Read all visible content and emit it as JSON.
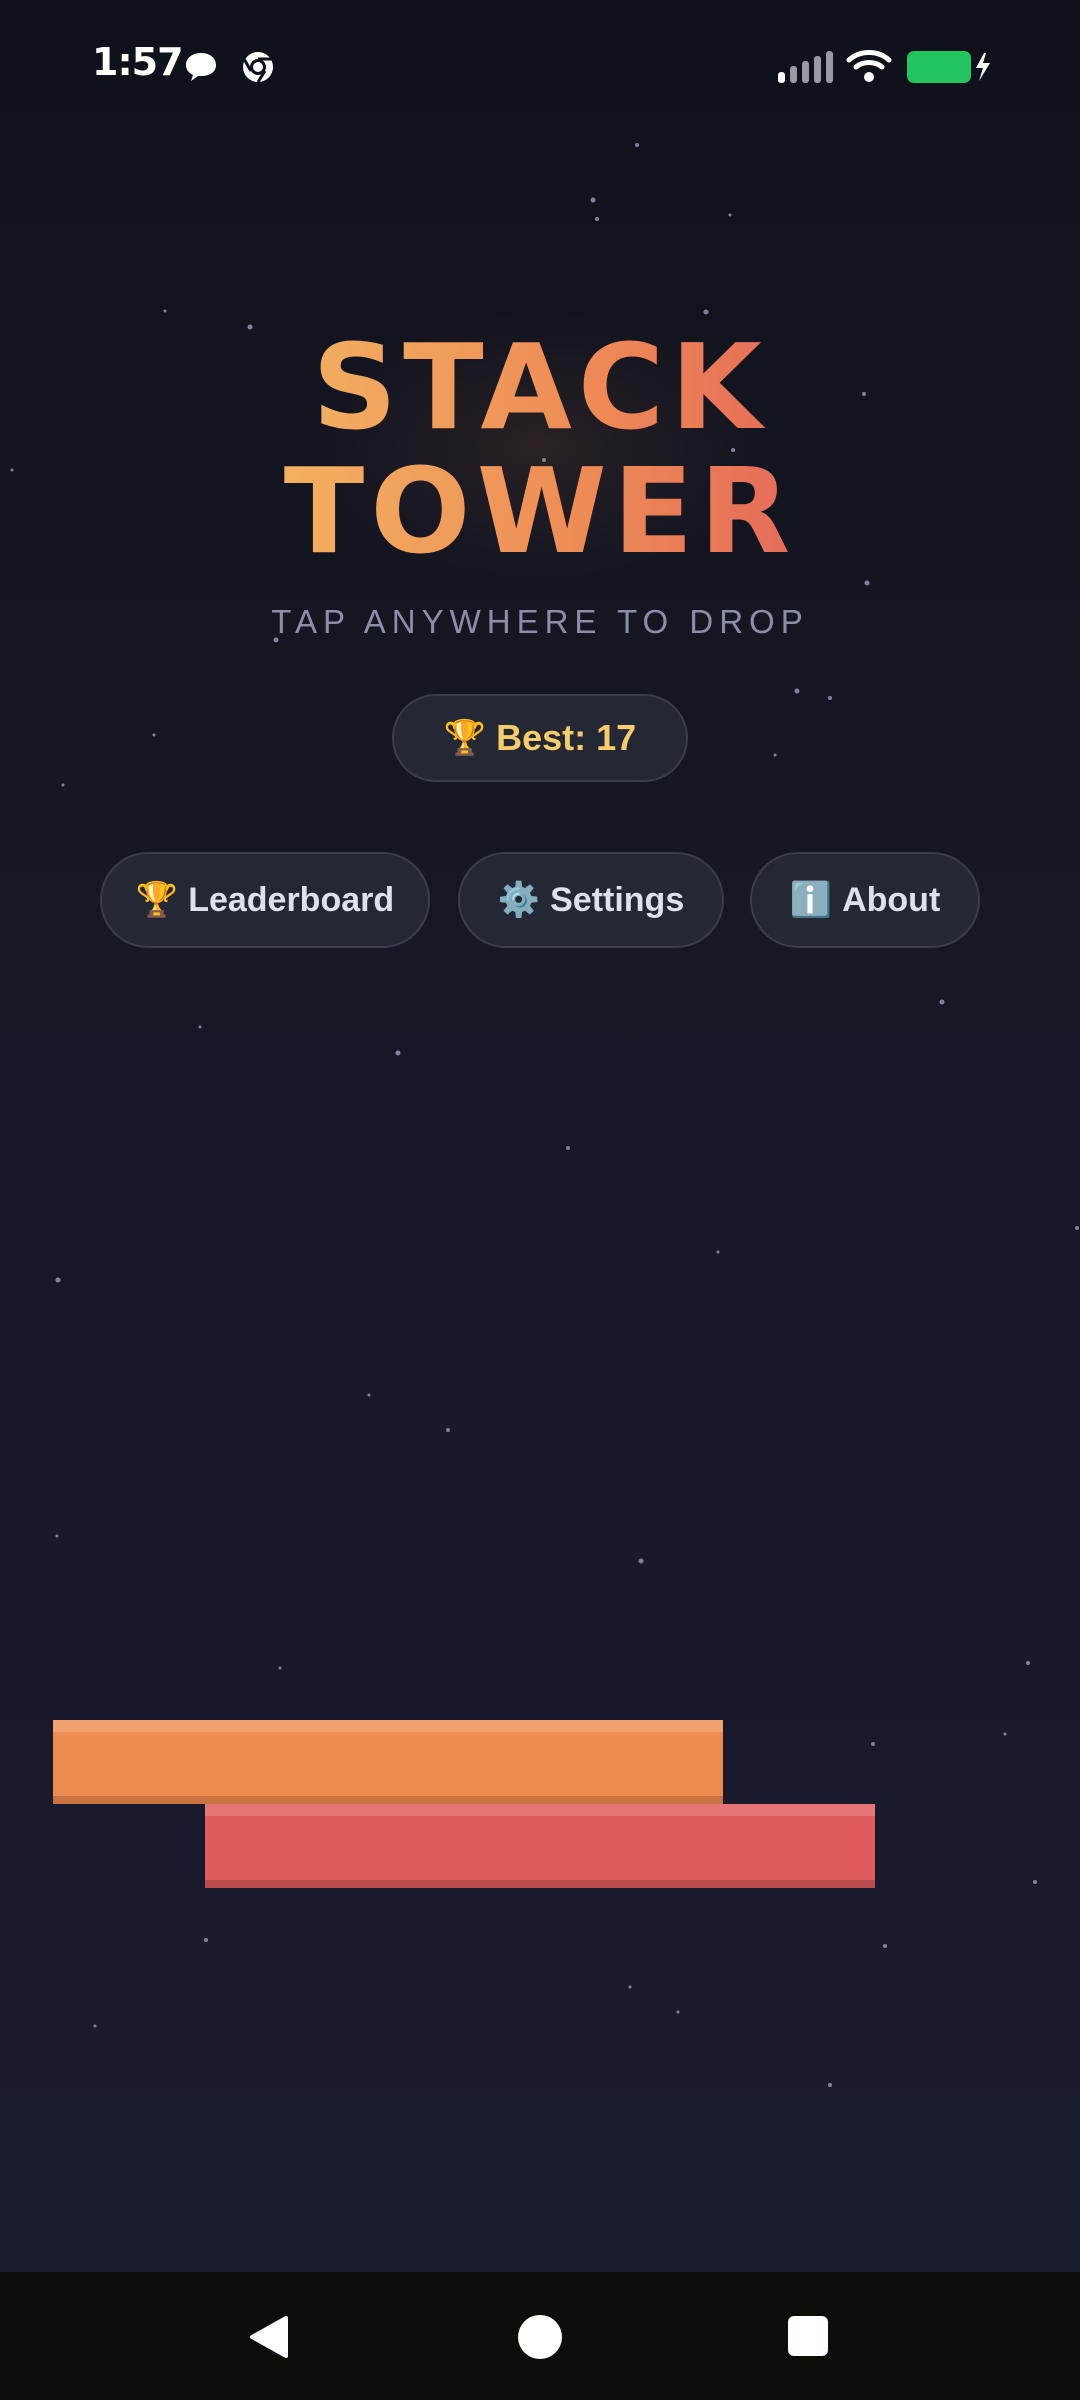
{
  "status_bar": {
    "time": "1:57",
    "left_icons": [
      "chat-bubble-icon",
      "chrome-icon"
    ],
    "right_icons": [
      "signal-icon",
      "wifi-icon",
      "battery-charging-icon"
    ],
    "battery_color": "#22c55e"
  },
  "game": {
    "title_line1": "STACK",
    "title_line2": "TOWER",
    "subtitle": "TAP ANYWHERE TO DROP",
    "best": {
      "icon": "🏆",
      "label": "Best:",
      "value": "17"
    },
    "colors": {
      "title_start": "#f4ba63",
      "title_end": "#e2615b",
      "block_orange": "#ee8b4f",
      "block_red": "#e05b5c"
    }
  },
  "menu": {
    "leaderboard": {
      "icon": "🏆",
      "label": "Leaderboard"
    },
    "settings": {
      "icon": "⚙️",
      "label": "Settings"
    },
    "about": {
      "icon": "ℹ️",
      "label": "About"
    }
  },
  "nav": [
    "back-icon",
    "home-icon",
    "recents-icon"
  ]
}
